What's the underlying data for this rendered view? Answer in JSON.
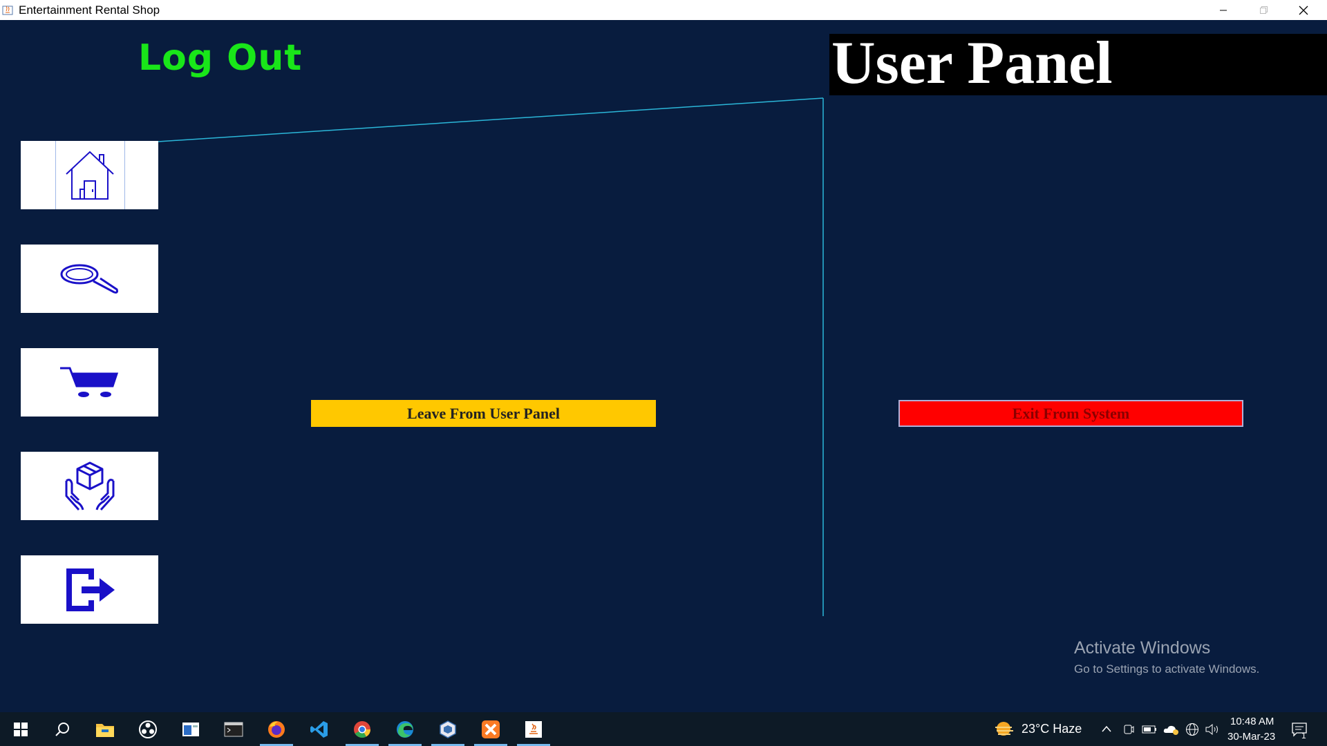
{
  "window": {
    "title": "Entertainment Rental Shop",
    "controls": [
      "minimize",
      "maximize",
      "close"
    ]
  },
  "header": {
    "logout_heading": "Log Out",
    "panel_heading": "User Panel"
  },
  "sidebar": {
    "items": [
      {
        "name": "home",
        "icon": "home-icon"
      },
      {
        "name": "search",
        "icon": "search-icon"
      },
      {
        "name": "cart",
        "icon": "cart-icon"
      },
      {
        "name": "rent",
        "icon": "package-hands-icon"
      },
      {
        "name": "logout",
        "icon": "exit-icon"
      }
    ]
  },
  "actions": {
    "leave_label": "Leave From User Panel",
    "exit_label": "Exit From System"
  },
  "watermark": {
    "line1": "Activate Windows",
    "line2": "Go to Settings to activate Windows."
  },
  "taskbar": {
    "apps": [
      "start-icon",
      "search-icon",
      "file-explorer-icon",
      "obs-icon",
      "window-app-icon",
      "terminal-icon",
      "firefox-icon",
      "vscode-icon",
      "chrome-icon",
      "edge-icon",
      "virtualbox-icon",
      "xampp-icon",
      "java-icon"
    ],
    "weather": "23°C  Haze",
    "time": "10:48 AM",
    "date": "30-Mar-23",
    "notification_count": "1"
  },
  "colors": {
    "background": "#081c3e",
    "logout_heading": "#19e619",
    "leave_button": "#ffc800",
    "exit_button": "#ff0000",
    "divider": "#2bb7d9",
    "icon": "#1a10c8"
  }
}
